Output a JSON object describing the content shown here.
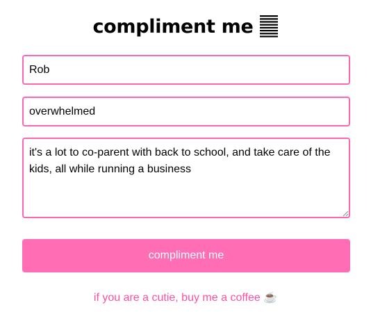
{
  "header": {
    "title": "compliment me",
    "logo_icon": "stacked-lines-icon"
  },
  "form": {
    "name_value": "Rob",
    "feeling_value": "overwhelmed",
    "details_value": "it's a lot to co-parent with back to school, and take care of the kids, all while running a business",
    "submit_label": "compliment me"
  },
  "footer": {
    "coffee_text": "if you are a cutie, buy me a coffee",
    "coffee_icon": "☕"
  },
  "colors": {
    "accent": "#ff66b2",
    "button": "#ff6eb4",
    "link": "#ff4fa3"
  }
}
